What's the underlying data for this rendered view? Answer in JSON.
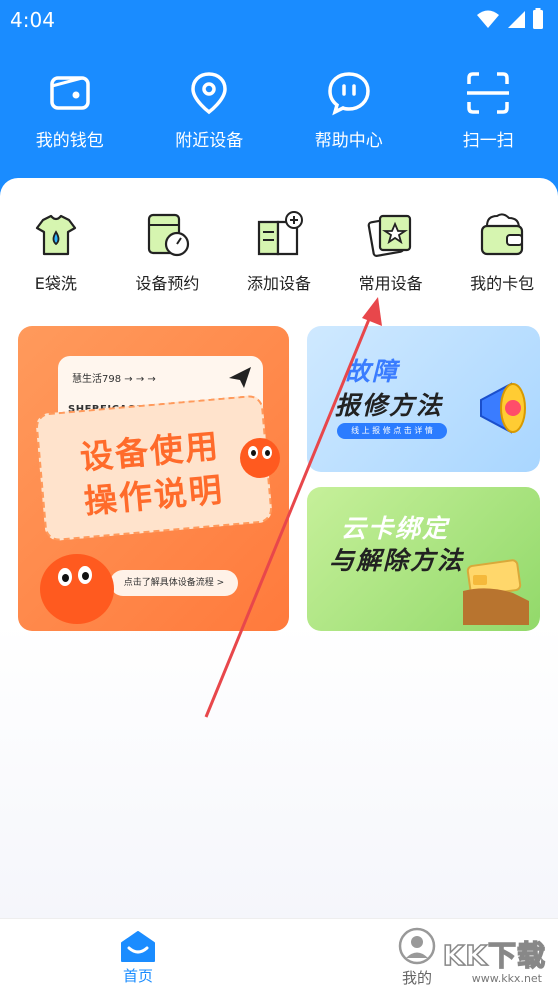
{
  "status_bar": {
    "time": "4:04"
  },
  "top_nav": [
    {
      "label": "我的钱包",
      "icon": "wallet-icon"
    },
    {
      "label": "附近设备",
      "icon": "location-pin-icon"
    },
    {
      "label": "帮助中心",
      "icon": "chat-bubble-icon"
    },
    {
      "label": "扫一扫",
      "icon": "scan-icon"
    }
  ],
  "services": [
    {
      "label": "E袋洗",
      "icon": "shirt-laundry-icon"
    },
    {
      "label": "设备预约",
      "icon": "appointment-gauge-icon"
    },
    {
      "label": "添加设备",
      "icon": "add-book-icon"
    },
    {
      "label": "常用设备",
      "icon": "star-card-icon"
    },
    {
      "label": "我的卡包",
      "icon": "card-wallet-icon"
    }
  ],
  "banner_main": {
    "top_text": "慧生活798  → → →",
    "sub_text": "SHEBEICAOZUOSHUOMING",
    "title_line1": "设备使用",
    "title_line2": "操作说明",
    "pill_text": "点击了解具体设备流程 >"
  },
  "banner_repair": {
    "title_line1": "故障",
    "title_line2": "报修方法",
    "pill_text": "线 上 报 修 点 击 详 情"
  },
  "banner_bind": {
    "title_line1": "云卡绑定",
    "title_line2": "与解除方法"
  },
  "bottom_tabs": [
    {
      "label": "首页",
      "icon": "home-icon",
      "active": true
    },
    {
      "label": "我的",
      "icon": "user-icon",
      "active": false
    }
  ],
  "watermark": {
    "text": "KK下载",
    "url_text": "www.kkx.net"
  },
  "colors": {
    "primary": "#1a8cff",
    "orange": "#ff7a3c",
    "green": "#92d96a",
    "arrow": "#e8474b"
  }
}
